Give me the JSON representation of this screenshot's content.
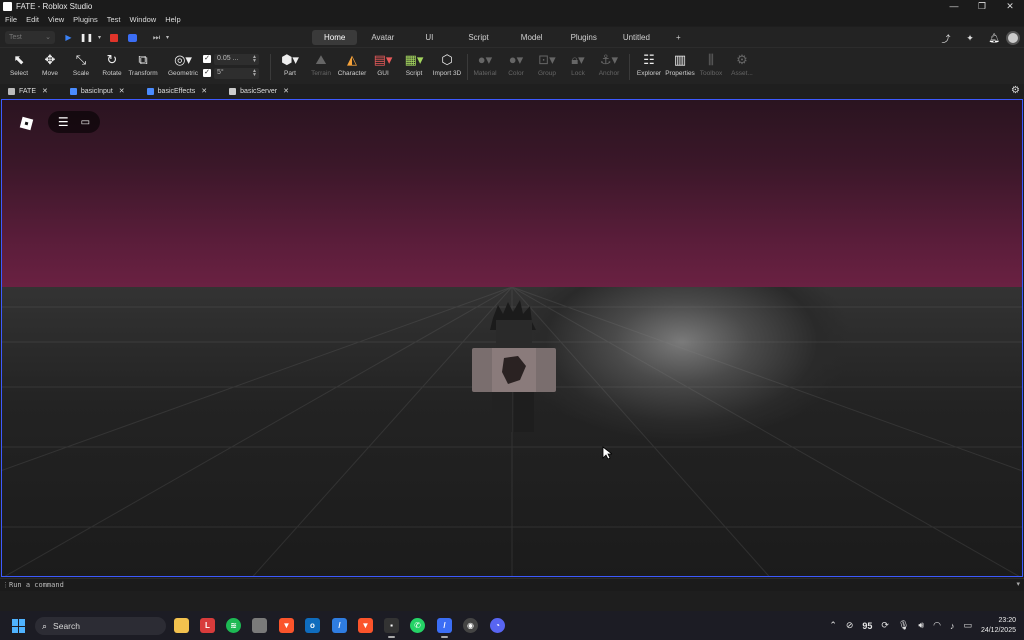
{
  "window": {
    "title": "FATE - Roblox Studio",
    "controls": [
      "minimize",
      "restore",
      "close"
    ]
  },
  "menubar": {
    "items": [
      "File",
      "Edit",
      "View",
      "Plugins",
      "Test",
      "Window",
      "Help"
    ]
  },
  "modebar": {
    "test_select": "Test",
    "tabs": [
      "Home",
      "Avatar",
      "UI",
      "Script",
      "Model",
      "Plugins",
      "Untitled"
    ],
    "active_tab": "Home",
    "add_tab": "+",
    "colors": {
      "play": "#3b82f6",
      "stop": "#e0342a",
      "studio": "#3b6ef5"
    }
  },
  "toolbar": {
    "tools": [
      {
        "label": "Select",
        "icon": "cursor-icon"
      },
      {
        "label": "Move",
        "icon": "move-icon"
      },
      {
        "label": "Scale",
        "icon": "scale-icon"
      },
      {
        "label": "Rotate",
        "icon": "rotate-icon"
      },
      {
        "label": "Transform",
        "icon": "transform-icon"
      },
      {
        "label": "Geometric",
        "icon": "geometric-icon"
      },
      {
        "label": "Part",
        "icon": "cube-icon"
      },
      {
        "label": "Terrain",
        "icon": "terrain-icon"
      },
      {
        "label": "Character",
        "icon": "character-icon"
      },
      {
        "label": "GUI",
        "icon": "gui-icon"
      },
      {
        "label": "Script",
        "icon": "script-icon"
      },
      {
        "label": "Import 3D",
        "icon": "import-icon"
      },
      {
        "label": "Material",
        "icon": "material-icon"
      },
      {
        "label": "Color",
        "icon": "color-icon"
      },
      {
        "label": "Group",
        "icon": "group-icon"
      },
      {
        "label": "Lock",
        "icon": "lock-icon"
      },
      {
        "label": "Anchor",
        "icon": "anchor-icon"
      },
      {
        "label": "Explorer",
        "icon": "explorer-icon"
      },
      {
        "label": "Properties",
        "icon": "properties-icon"
      },
      {
        "label": "Toolbox",
        "icon": "toolbox-icon"
      },
      {
        "label": "Asset...",
        "icon": "asset-icon"
      }
    ],
    "snap": {
      "move_value": "0.05 ...",
      "rotate_value": "5°"
    }
  },
  "doc_tabs": [
    {
      "label": "FATE",
      "color": "#bbbbbb"
    },
    {
      "label": "basicInput",
      "color": "#4a8cff"
    },
    {
      "label": "basicEffects",
      "color": "#4a8cff"
    },
    {
      "label": "basicServer",
      "color": "#cccccc"
    }
  ],
  "viewport": {
    "sky_color": "#5a1d3a",
    "ground_color": "#222222",
    "border_color": "#3d5afe"
  },
  "command_bar": {
    "placeholder": "Run a command"
  },
  "taskbar": {
    "search_label": "Search",
    "apps": [
      {
        "name": "file-explorer",
        "color": "#f2c14e"
      },
      {
        "name": "app-l",
        "color": "#d83b3b",
        "glyph": "L"
      },
      {
        "name": "spotify",
        "color": "#1db954"
      },
      {
        "name": "app-gray",
        "color": "#7a7a7a"
      },
      {
        "name": "brave",
        "color": "#fb542b"
      },
      {
        "name": "outlook",
        "color": "#0f6cbd"
      },
      {
        "name": "app-blue",
        "color": "#2f7de1"
      },
      {
        "name": "brave-2",
        "color": "#fb542b"
      },
      {
        "name": "roblox-studio",
        "color": "#333333"
      },
      {
        "name": "whatsapp",
        "color": "#25d366"
      },
      {
        "name": "app-studio",
        "color": "#3b6ef5"
      },
      {
        "name": "obs",
        "color": "#444444"
      },
      {
        "name": "discord",
        "color": "#5865f2"
      }
    ],
    "tray": {
      "badge_number": "95",
      "time": "23:20",
      "date": "24/12/2025"
    }
  }
}
